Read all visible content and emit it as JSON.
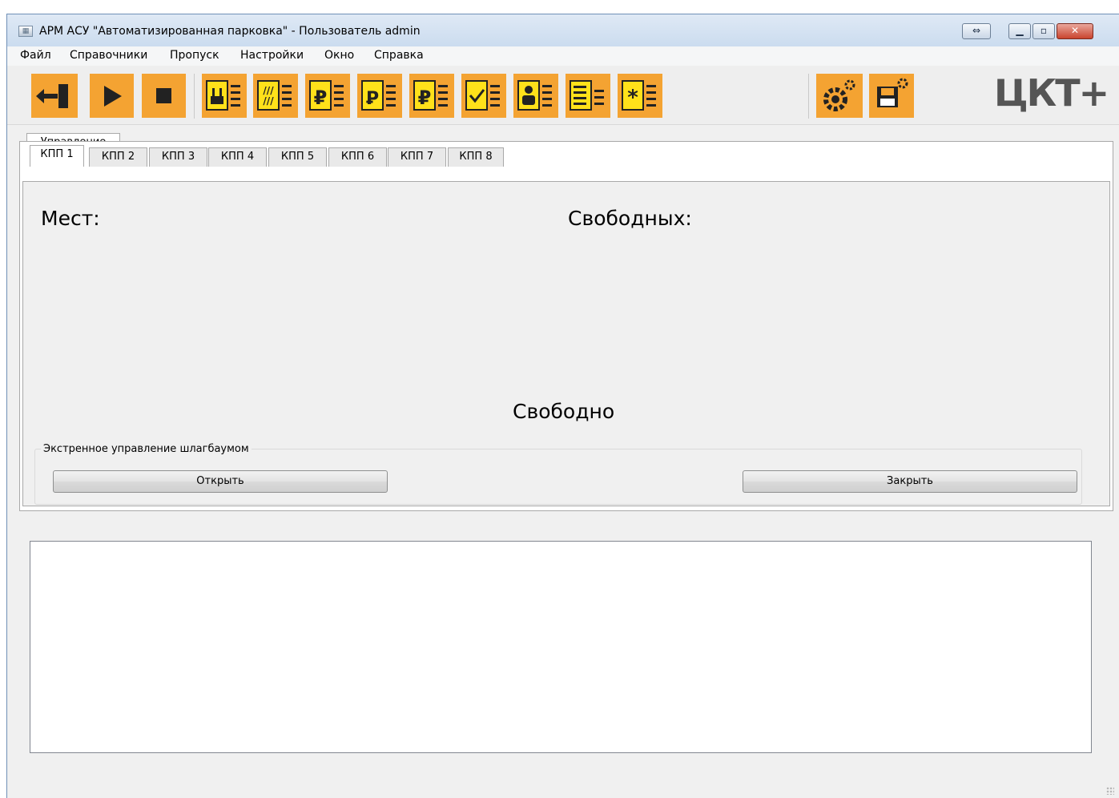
{
  "window": {
    "title": "АРМ АСУ \"Автоматизированная парковка\" - Пользователь admin",
    "caption_buttons": [
      "⇔",
      "▁",
      "▫",
      "✕"
    ]
  },
  "menu": [
    "Файл",
    "Справочники",
    "Пропуск",
    "Настройки",
    "Окно",
    "Справка"
  ],
  "toolbar": {
    "icons": [
      "exit-icon",
      "play-icon",
      "stop-icon",
      "parking-list-icon",
      "passes-list-icon",
      "tariff-list-icon",
      "tariff-p-list-icon",
      "payment-list-icon",
      "check-list-icon",
      "users-list-icon",
      "report-list-icon",
      "asterisk-list-icon",
      "gear-settings-icon",
      "save-settings-icon"
    ],
    "accent": "#f4a332",
    "logo": "ЦКТ+"
  },
  "outer_tab": "Управление",
  "kpp_tabs": [
    "КПП 1",
    "КПП 2",
    "КПП 3",
    "КПП 4",
    "КПП 5",
    "КПП 6",
    "КПП 7",
    "КПП 8"
  ],
  "panel": {
    "places_label": "Мест:",
    "free_label": "Свободных:",
    "status": "Свободно"
  },
  "barrier": {
    "group_title": "Экстренное управление шлагбаумом",
    "open_label": "Открыть",
    "close_label": "Закрыть"
  }
}
